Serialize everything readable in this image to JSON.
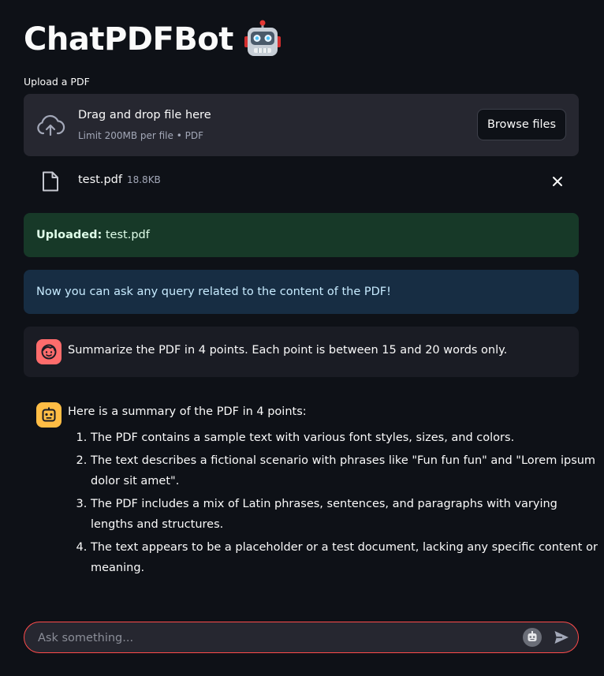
{
  "app": {
    "title": "ChatPDFBot"
  },
  "uploader": {
    "label": "Upload a PDF",
    "drag_text": "Drag and drop file here",
    "limit_text": "Limit 200MB per file • PDF",
    "browse_label": "Browse files",
    "file": {
      "name": "test.pdf",
      "size": "18.8KB"
    }
  },
  "alerts": {
    "success_bold": "Uploaded:",
    "success_text": " test.pdf",
    "info_text": "Now you can ask any query related to the content of the PDF!"
  },
  "chat": {
    "user_message": "Summarize the PDF in 4 points. Each point is between 15 and 20 words only.",
    "assistant_intro": "Here is a summary of the PDF in 4 points:",
    "assistant_points": [
      "The PDF contains a sample text with various font styles, sizes, and colors.",
      "The text describes a fictional scenario with phrases like \"Fun fun fun\" and \"Lorem ipsum dolor sit amet\".",
      "The PDF includes a mix of Latin phrases, sentences, and paragraphs with varying lengths and structures.",
      "The text appears to be a placeholder or a test document, lacking any specific content or meaning."
    ],
    "input_placeholder": "Ask something..."
  },
  "icons": {
    "title_emoji": "robot-face-icon",
    "upload": "cloud-upload-icon",
    "file": "file-icon",
    "remove": "close-icon",
    "user_avatar": "user-face-icon",
    "assistant_avatar": "robot-icon",
    "send": "send-icon"
  },
  "colors": {
    "background": "#0e1117",
    "accent": "#ff4b4b",
    "success_bg": "#173928",
    "info_bg": "#172d43",
    "user_avatar": "#ff6c6c",
    "assistant_avatar": "#ffbd45"
  }
}
